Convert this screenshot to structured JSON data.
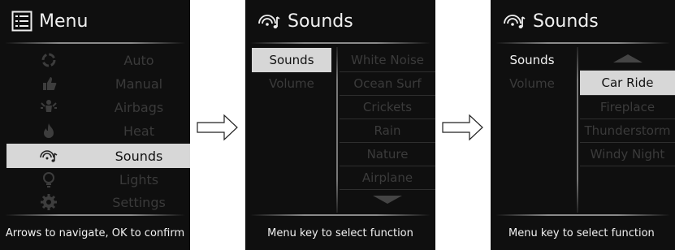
{
  "screen1": {
    "title": "Menu",
    "items": [
      {
        "label": "Auto",
        "icon": "auto-cycle-icon"
      },
      {
        "label": "Manual",
        "icon": "thumb-icon"
      },
      {
        "label": "Airbags",
        "icon": "airbag-icon"
      },
      {
        "label": "Heat",
        "icon": "flame-icon"
      },
      {
        "label": "Sounds",
        "icon": "sound-icon",
        "selected": true
      },
      {
        "label": "Lights",
        "icon": "bulb-icon"
      },
      {
        "label": "Settings",
        "icon": "gear-icon"
      }
    ],
    "footer": "Arrows to navigate, OK to confirm"
  },
  "screen2": {
    "title": "Sounds",
    "left": [
      "Sounds",
      "Volume"
    ],
    "right": [
      "White Noise",
      "Ocean Surf",
      "Crickets",
      "Rain",
      "Nature",
      "Airplane"
    ],
    "footer": "Menu key to select function"
  },
  "screen3": {
    "title": "Sounds",
    "left": [
      "Sounds",
      "Volume"
    ],
    "right": [
      "Car Ride",
      "Fireplace",
      "Thunderstorm",
      "Windy Night"
    ],
    "footer": "Menu key to select function"
  },
  "colors": {
    "screen_bg": "#0f0f0f",
    "highlight": "#d7d7d7",
    "dim_text": "#3b3b3b",
    "bright_text": "#f2f2f2"
  }
}
